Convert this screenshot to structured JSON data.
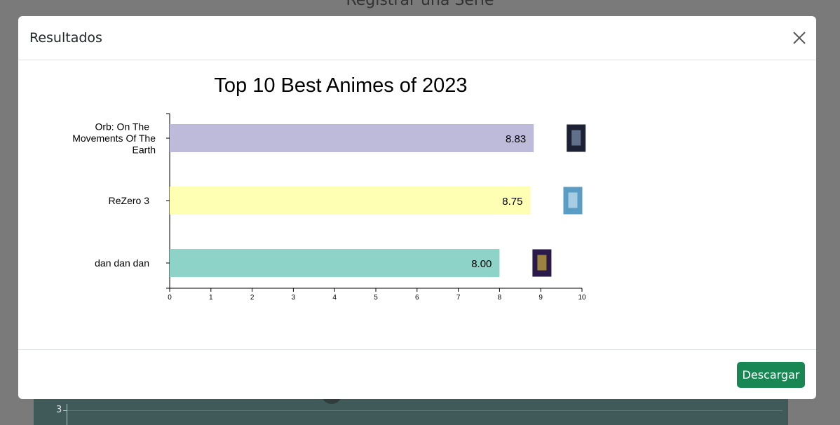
{
  "background": {
    "page_title": "Registrar una Serie",
    "tick_label": "3"
  },
  "modal": {
    "title": "Resultados",
    "download_label": "Descargar"
  },
  "chart_data": {
    "type": "bar",
    "orientation": "horizontal",
    "title": "Top 10 Best Animes of 2023",
    "categories": [
      "Orb: On The Movements Of The Earth",
      "ReZero 3",
      "dan dan dan"
    ],
    "category_label_lines": [
      [
        "Orb: On The",
        "Movements Of The",
        "Earth"
      ],
      [
        "ReZero 3"
      ],
      [
        "dan dan dan"
      ]
    ],
    "values": [
      8.83,
      8.75,
      8.0
    ],
    "value_labels": [
      "8.83",
      "8.75",
      "8.00"
    ],
    "colors": [
      "#bebada",
      "#ffffb3",
      "#8dd3c7"
    ],
    "xlim": [
      0,
      10
    ],
    "xticks": [
      "0",
      "1",
      "2",
      "3",
      "4",
      "5",
      "6",
      "7",
      "8",
      "9",
      "10"
    ],
    "grid": false,
    "legend": "none"
  }
}
